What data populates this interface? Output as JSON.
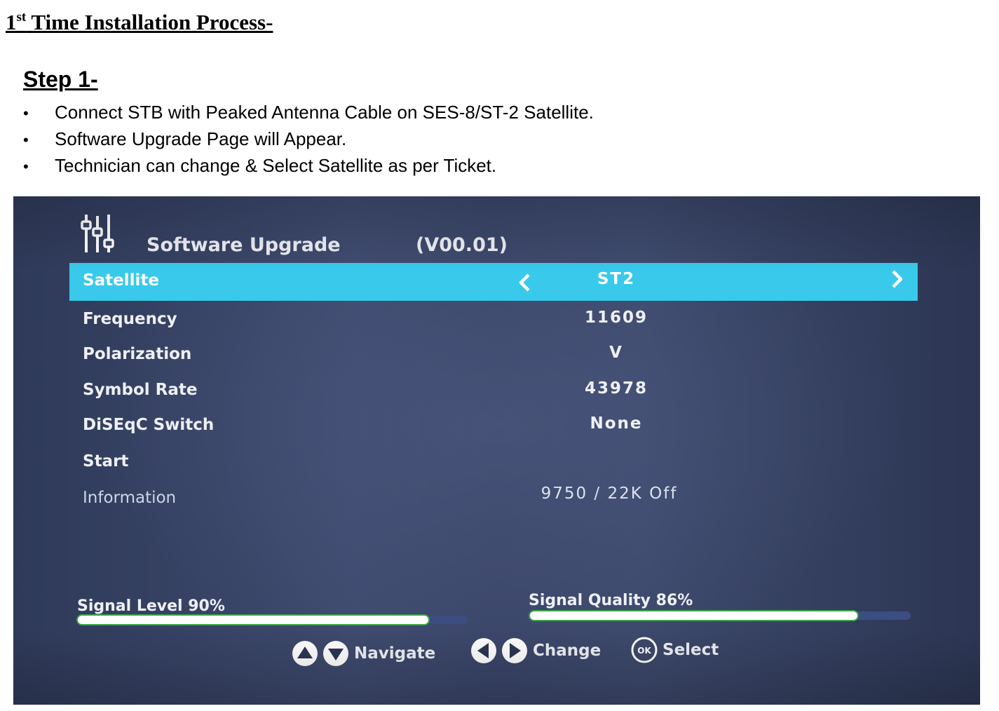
{
  "document": {
    "title_num": "1",
    "title_sup": "st",
    "title_rest": " Time Installation Process-",
    "step_heading": "Step 1-",
    "bullets": [
      "Connect STB with Peaked Antenna Cable on SES-8/ST-2 Satellite.",
      "Software Upgrade Page will Appear.",
      "Technician can change & Select Satellite as per Ticket."
    ],
    "bullet_glyph": "•"
  },
  "screen": {
    "menu_icon": "settings-sliders-icon",
    "title": "Software Upgrade",
    "version": "(V00.01)",
    "rows": [
      {
        "label": "Satellite",
        "value": "ST2"
      },
      {
        "label": "Frequency",
        "value": "11609"
      },
      {
        "label": "Polarization",
        "value": "V"
      },
      {
        "label": "Symbol Rate",
        "value": "43978"
      },
      {
        "label": "DiSEqC Switch",
        "value": "None"
      },
      {
        "label": "Start",
        "value": ""
      },
      {
        "label": "Information",
        "value": "9750 / 22K Off"
      }
    ],
    "signal_level": {
      "label": "Signal Level 90%",
      "percent": 90
    },
    "signal_quality": {
      "label": "Signal Quality 86%",
      "percent": 86
    },
    "hints": {
      "navigate": "Navigate",
      "change": "Change",
      "select": "Select",
      "ok_glyph": "OK"
    },
    "colors": {
      "highlight": "#38c9eb",
      "background": "#3a4568",
      "bar_track": "#3c4d82",
      "bar_fill": "#ffffff"
    }
  }
}
